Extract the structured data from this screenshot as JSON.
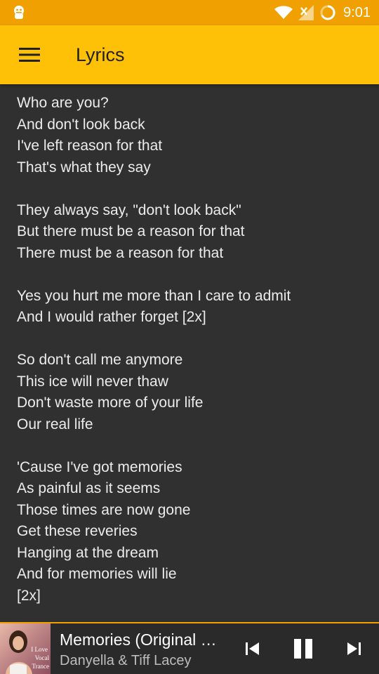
{
  "statusbar": {
    "time": "9:01",
    "icons": [
      "notification-icon",
      "wifi-icon",
      "signal-no-sim-icon",
      "battery-charging-icon"
    ]
  },
  "appbar": {
    "title": "Lyrics",
    "menu_icon": "hamburger-menu-icon",
    "color": "#FFC107"
  },
  "lyrics": {
    "lines": [
      "Who are you?",
      "And don't look back",
      "I've left reason for that",
      "That's what they say",
      "",
      "They always say, \"don't look back\"",
      "But there must be a reason for that",
      "There must be a reason for that",
      "",
      "Yes you hurt me more than I care to admit",
      "And I would rather forget [2x]",
      "",
      "So don't call me anymore",
      "This ice will never thaw",
      "Don't waste more of your life",
      "Our real life",
      "",
      "'Cause I've got memories",
      "As painful as it seems",
      "Those times are now gone",
      "Get these reveries",
      "Hanging at the dream",
      "And for memories will lie",
      "[2x]"
    ]
  },
  "player": {
    "title": "Memories (Original …",
    "artist": "Danyella & Tiff Lacey",
    "album_art_text": [
      "I Love",
      "Vocal",
      "Trance"
    ],
    "controls": [
      "skip-previous-icon",
      "pause-icon",
      "skip-next-icon"
    ],
    "accent_color": "#F0A000"
  }
}
